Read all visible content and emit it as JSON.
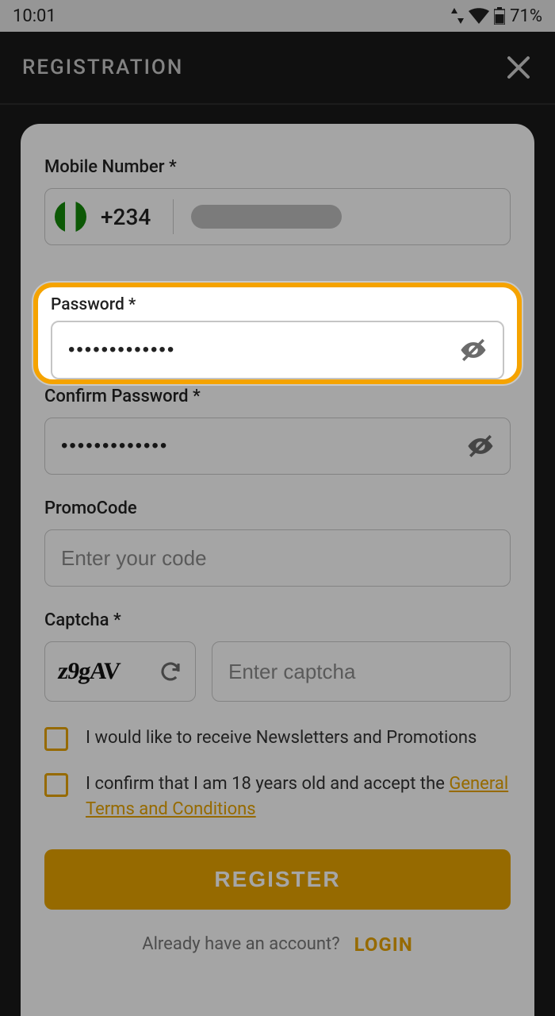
{
  "status": {
    "time": "10:01",
    "battery": "71%"
  },
  "header": {
    "title": "REGISTRATION"
  },
  "fields": {
    "mobile": {
      "label": "Mobile Number *",
      "dialcode": "+234"
    },
    "password": {
      "label": "Password *",
      "value": "•••••••••••••"
    },
    "confirm": {
      "label": "Confirm Password *",
      "value": "•••••••••••••"
    },
    "promo": {
      "label": "PromoCode",
      "placeholder": "Enter your code"
    },
    "captcha": {
      "label": "Captcha *",
      "image_text": "z9gAV",
      "placeholder": "Enter captcha"
    }
  },
  "checks": {
    "newsletter": "I would like to receive Newsletters and Promotions",
    "age_prefix": "I confirm that I am 18 years old and accept the  ",
    "terms_link": "General Terms and Conditions"
  },
  "buttons": {
    "register": "REGISTER"
  },
  "footer": {
    "text": "Already have an account?",
    "login": "LOGIN"
  }
}
